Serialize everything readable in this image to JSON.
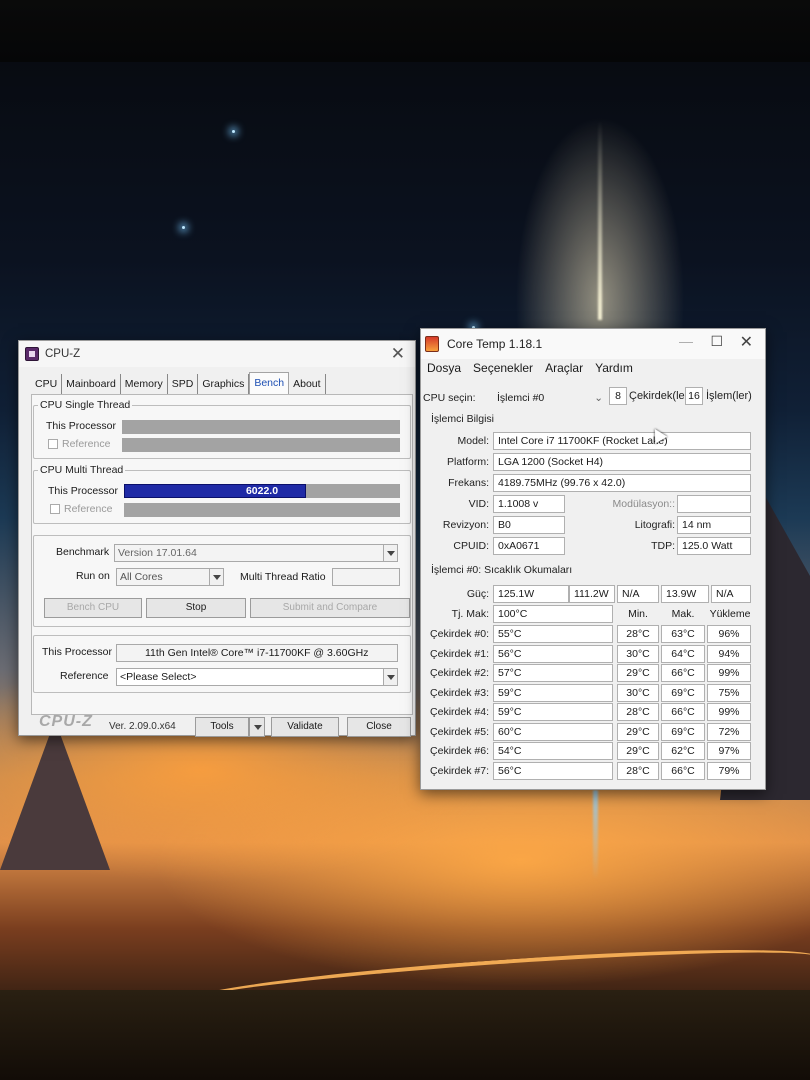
{
  "cpuz": {
    "title": "CPU-Z",
    "tabs": [
      "CPU",
      "Mainboard",
      "Memory",
      "SPD",
      "Graphics",
      "Bench",
      "About"
    ],
    "active_tab": "Bench",
    "single_thread": {
      "legend": "CPU Single Thread",
      "this_processor_label": "This Processor",
      "reference_label": "Reference"
    },
    "multi_thread": {
      "legend": "CPU Multi Thread",
      "this_processor_label": "This Processor",
      "this_processor_value": "6022.0",
      "this_processor_fill": 0.66,
      "reference_label": "Reference"
    },
    "benchmark_label": "Benchmark",
    "benchmark_value": "Version 17.01.64",
    "run_on_label": "Run on",
    "run_on_value": "All Cores",
    "ratio_label": "Multi Thread Ratio",
    "bench_cpu_btn": "Bench CPU",
    "stop_btn": "Stop",
    "submit_btn": "Submit and Compare",
    "this_processor_label": "This Processor",
    "this_processor_name": "11th Gen Intel® Core™ i7-11700KF @ 3.60GHz",
    "reference_label": "Reference",
    "reference_select": "<Please Select>",
    "logo": "CPU-Z",
    "version": "Ver. 2.09.0.x64",
    "tools_btn": "Tools",
    "validate_btn": "Validate",
    "close_btn": "Close"
  },
  "coretemp": {
    "title": "Core Temp 1.18.1",
    "menu": [
      "Dosya",
      "Seçenekler",
      "Araçlar",
      "Yardım"
    ],
    "cpu_select_label": "CPU seçin:",
    "cpu_select_value": "İşlemci #0",
    "cores_count": "8",
    "cores_label": "Çekirdek(le",
    "threads_count": "16",
    "threads_label": "İşlem(ler)",
    "info_section": "İşlemci Bilgisi",
    "model_label": "Model:",
    "model_value": "Intel Core i7 11700KF (Rocket Lake)",
    "platform_label": "Platform:",
    "platform_value": "LGA 1200 (Socket H4)",
    "freq_label": "Frekans:",
    "freq_value": "4189.75MHz (99.76 x 42.0)",
    "vid_label": "VID:",
    "vid_value": "1.1008 v",
    "modulation_label": "Modülasyon::",
    "revision_label": "Revizyon:",
    "revision_value": "B0",
    "litho_label": "Litografi:",
    "litho_value": "14 nm",
    "cpuid_label": "CPUID:",
    "cpuid_value": "0xA0671",
    "tdp_label": "TDP:",
    "tdp_value": "125.0 Watt",
    "temps_section": "İşlemci #0: Sıcaklık Okumaları",
    "power_label": "Güç:",
    "power_values": [
      "125.1W",
      "111.2W",
      "N/A",
      "13.9W",
      "N/A"
    ],
    "tjmax_label": "Tj. Mak:",
    "tjmax_value": "100°C",
    "col_min": "Min.",
    "col_max": "Mak.",
    "col_load": "Yükleme",
    "cores": [
      {
        "label": "Çekirdek #0:",
        "temp": "55°C",
        "min": "28°C",
        "max": "63°C",
        "load": "96%"
      },
      {
        "label": "Çekirdek #1:",
        "temp": "56°C",
        "min": "30°C",
        "max": "64°C",
        "load": "94%"
      },
      {
        "label": "Çekirdek #2:",
        "temp": "57°C",
        "min": "29°C",
        "max": "66°C",
        "load": "99%"
      },
      {
        "label": "Çekirdek #3:",
        "temp": "59°C",
        "min": "30°C",
        "max": "69°C",
        "load": "75%"
      },
      {
        "label": "Çekirdek #4:",
        "temp": "59°C",
        "min": "28°C",
        "max": "66°C",
        "load": "99%"
      },
      {
        "label": "Çekirdek #5:",
        "temp": "60°C",
        "min": "29°C",
        "max": "69°C",
        "load": "72%"
      },
      {
        "label": "Çekirdek #6:",
        "temp": "54°C",
        "min": "29°C",
        "max": "62°C",
        "load": "97%"
      },
      {
        "label": "Çekirdek #7:",
        "temp": "56°C",
        "min": "28°C",
        "max": "66°C",
        "load": "79%"
      }
    ]
  }
}
